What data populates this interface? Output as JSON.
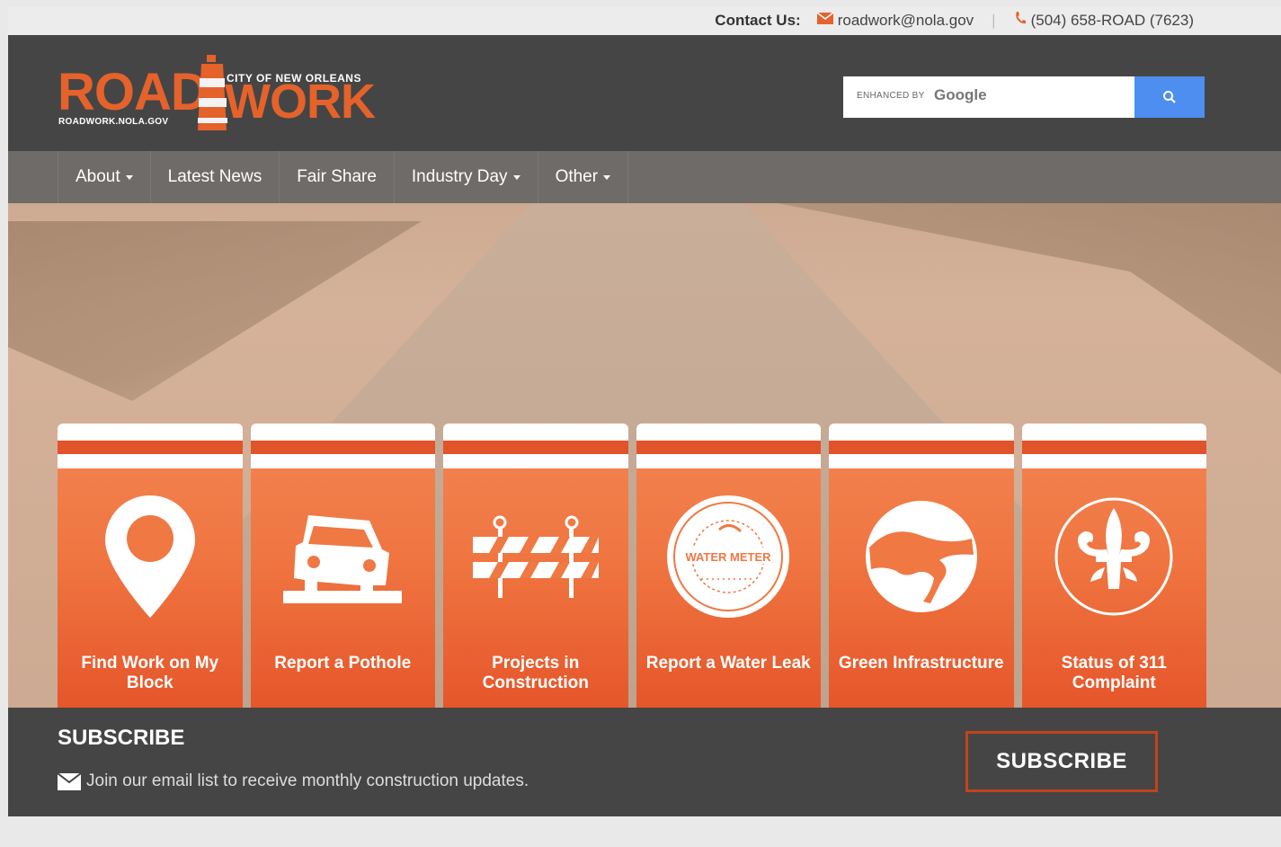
{
  "topbar": {
    "contact_label": "Contact Us:",
    "email": "roadwork@nola.gov",
    "phone": "(504) 658-ROAD (7623)"
  },
  "logo": {
    "word1": "ROAD",
    "word2": "WORK",
    "city": "CITY OF NEW ORLEANS",
    "url": "ROADWORK.NOLA.GOV"
  },
  "search": {
    "enhanced_by": "ENHANCED BY",
    "provider": "Google",
    "icon": "search-icon"
  },
  "nav": {
    "items": [
      {
        "label": "About",
        "dropdown": true
      },
      {
        "label": "Latest News",
        "dropdown": false
      },
      {
        "label": "Fair Share",
        "dropdown": false
      },
      {
        "label": "Industry Day",
        "dropdown": true
      },
      {
        "label": "Other",
        "dropdown": true
      }
    ]
  },
  "tiles": [
    {
      "label": "Find Work on My Block",
      "icon": "map-pin-icon"
    },
    {
      "label": "Report a Pothole",
      "icon": "car-pothole-icon"
    },
    {
      "label": "Projects in Construction",
      "icon": "barricade-icon"
    },
    {
      "label": "Report a Water Leak",
      "icon": "water-meter-icon",
      "seal_text": "WATER METER"
    },
    {
      "label": "Green Infrastructure",
      "icon": "green-infrastructure-icon"
    },
    {
      "label": "Status of 311 Complaint",
      "icon": "fleur-de-lis-icon"
    }
  ],
  "subscribe": {
    "title": "SUBSCRIBE",
    "text": "Join our email list to receive monthly construction updates.",
    "button": "SUBSCRIBE"
  },
  "colors": {
    "accent": "#e5622b",
    "header_bg": "#454545",
    "nav_bg": "#6e6b69",
    "search_button": "#4d8ef0"
  }
}
